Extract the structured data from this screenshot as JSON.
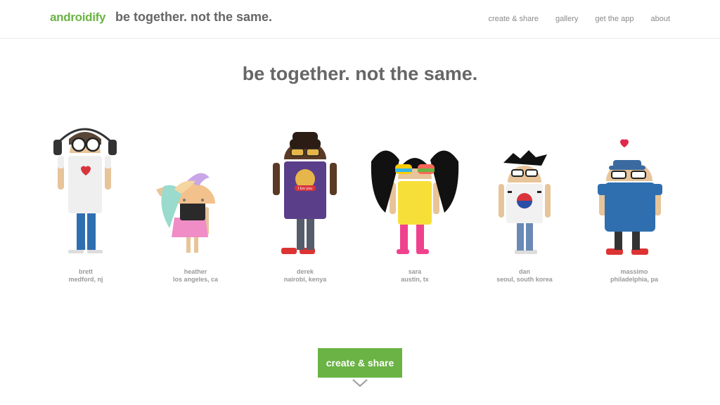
{
  "header": {
    "brand": "androidify",
    "tagline": "be together. not the same.",
    "nav": [
      "create & share",
      "gallery",
      "get the app",
      "about"
    ]
  },
  "hero": {
    "title": "be together. not the same."
  },
  "characters": [
    {
      "name": "brett",
      "location": "medford, nj"
    },
    {
      "name": "heather",
      "location": "los angeles, ca"
    },
    {
      "name": "derek",
      "location": "nairobi, kenya"
    },
    {
      "name": "sara",
      "location": "austin, tx"
    },
    {
      "name": "dan",
      "location": "seoul, south korea"
    },
    {
      "name": "massimo",
      "location": "philadelphia, pa"
    }
  ],
  "shirt_text": "I luv you",
  "cta": {
    "label": "create & share"
  },
  "colors": {
    "brand_green": "#6ab344",
    "skin": "#e7c49a",
    "text_gray": "#666666"
  }
}
